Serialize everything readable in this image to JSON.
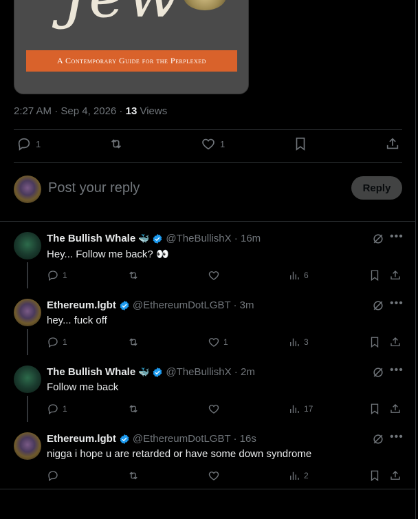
{
  "book": {
    "title_fragment": "Jew",
    "subtitle": "A Contemporary Guide for the Perplexed"
  },
  "tweet": {
    "time": "2:27 AM · Sep 4, 2026 · ",
    "views_count": "13",
    "views_label": " Views",
    "replies": "1",
    "reposts": "",
    "likes": "1"
  },
  "compose": {
    "placeholder": "Post your reply",
    "button": "Reply"
  },
  "replies": [
    {
      "name": "The Bullish Whale",
      "handle": "@TheBullishX · 16m",
      "text": "Hey... Follow me back? 👀",
      "replies": "1",
      "reposts": "",
      "likes": "",
      "views": "6",
      "avatar": "whale",
      "whale_emoji": true
    },
    {
      "name": "Ethereum.lgbt",
      "handle": "@EthereumDotLGBT · 3m",
      "text": "hey... fuck off",
      "replies": "1",
      "reposts": "",
      "likes": "1",
      "views": "3",
      "avatar": "eth",
      "whale_emoji": false
    },
    {
      "name": "The Bullish Whale",
      "handle": "@TheBullishX · 2m",
      "text": "Follow me back",
      "replies": "1",
      "reposts": "",
      "likes": "",
      "views": "17",
      "avatar": "whale",
      "whale_emoji": true
    },
    {
      "name": "Ethereum.lgbt",
      "handle": "@EthereumDotLGBT · 16s",
      "text": "nigga i hope u are retarded or have some down syndrome",
      "replies": "",
      "reposts": "",
      "likes": "",
      "views": "2",
      "avatar": "eth",
      "whale_emoji": false
    }
  ],
  "colors": {
    "background": "#000000",
    "text": "#e7e9ea",
    "muted": "#71767b",
    "verified": "#1d9bf0",
    "banner": "#d9622b"
  }
}
